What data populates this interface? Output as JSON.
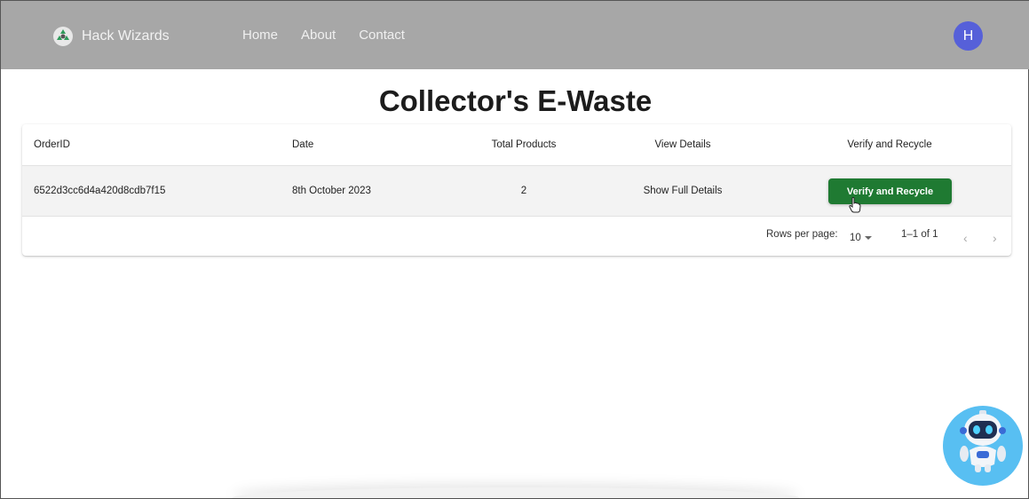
{
  "navbar": {
    "brand": "Hack Wizards",
    "links": [
      "Home",
      "About",
      "Contact"
    ],
    "avatar_letter": "H",
    "colors": {
      "bar": "#a7a7a7",
      "avatar": "#5660d9"
    }
  },
  "page": {
    "title": "Collector's E-Waste"
  },
  "table": {
    "headers": [
      "OrderID",
      "Date",
      "Total Products",
      "View Details",
      "Verify and Recycle"
    ],
    "rows": [
      {
        "order_id": "6522d3cc6d4a420d8cdb7f15",
        "date": "8th October 2023",
        "total_products": "2",
        "view_details": "Show Full Details",
        "action_label": "Verify and Recycle"
      }
    ],
    "pagination": {
      "rows_per_page_label": "Rows per page:",
      "rows_per_page": "10",
      "range": "1–1 of 1",
      "prev_icon": "chevron-left-icon",
      "next_icon": "chevron-right-icon"
    },
    "colors": {
      "action_button": "#1f7a32",
      "row_bg": "#f3f3f3"
    }
  },
  "chatbot": {
    "icon": "robot-icon",
    "color": "#58bff2"
  }
}
